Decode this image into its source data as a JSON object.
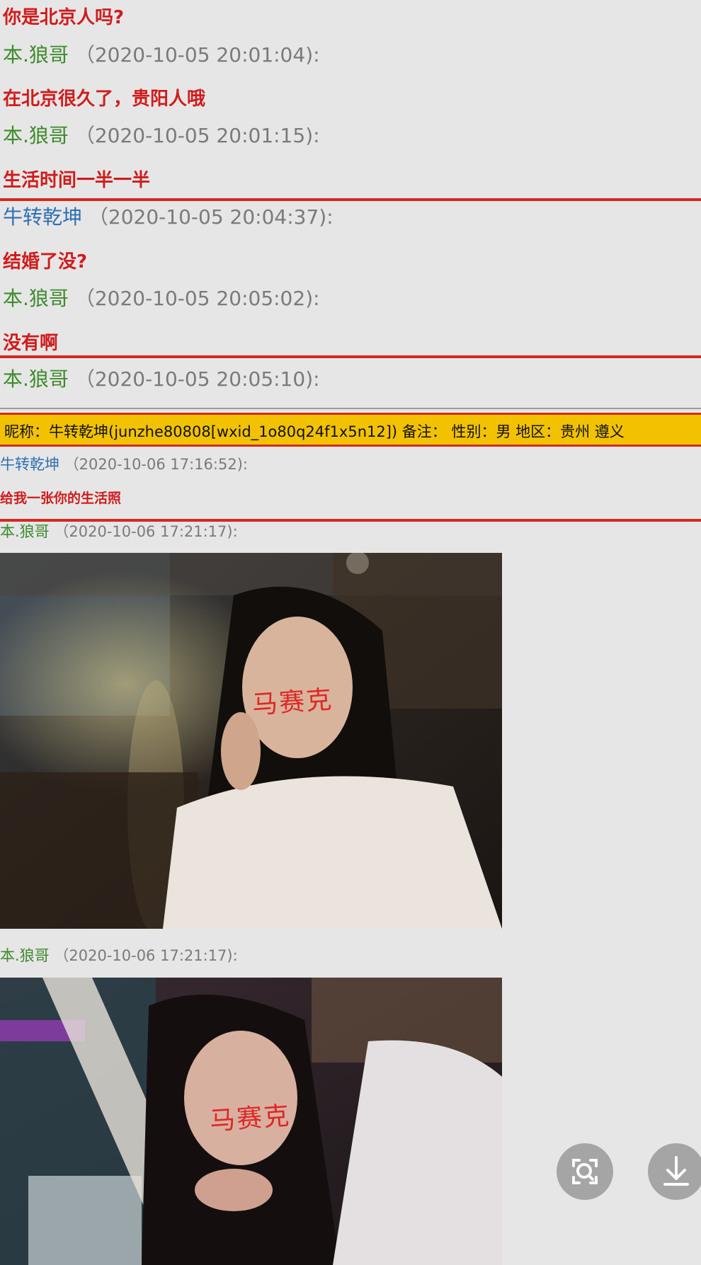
{
  "messages": [
    {
      "text": "你是北京人吗?"
    },
    {
      "sender": "本.狼哥",
      "time": "（2020-10-05 20:01:04):"
    },
    {
      "text": "在北京很久了，贵阳人哦"
    },
    {
      "sender": "本.狼哥",
      "time": "（2020-10-05 20:01:15):"
    },
    {
      "text": "生活时间一半一半"
    },
    {
      "sender": "牛转乾坤",
      "time": "（2020-10-05 20:04:37):"
    },
    {
      "text": "结婚了没?"
    },
    {
      "sender": "本.狼哥",
      "time": "（2020-10-05 20:05:02):"
    },
    {
      "text": "没有啊"
    },
    {
      "sender": "本.狼哥",
      "time": "（2020-10-05 20:05:10):"
    }
  ],
  "info_bar": "昵称：牛转乾坤(junzhe80808[wxid_1o80q24f1x5n12]) 备注：  性别：男  地区：贵州 遵义",
  "lower": [
    {
      "sender": "牛转乾坤",
      "time": "（2020-10-06 17:16:52):"
    },
    {
      "text": "给我一张你的生活照"
    },
    {
      "sender": "本.狼哥",
      "time": "（2020-10-06 17:21:17):"
    },
    {
      "sender": "本.狼哥",
      "time": "（2020-10-06 17:21:17):"
    }
  ],
  "watermark": "马赛克",
  "icons": {
    "scan": "image-search-icon",
    "download": "download-icon"
  },
  "colors": {
    "message": "#d01c1c",
    "sender_green": "#3e8a2c",
    "sender_blue": "#2f6fb1",
    "highlight_bar": "#f2c200",
    "border_red": "#d42a20"
  }
}
